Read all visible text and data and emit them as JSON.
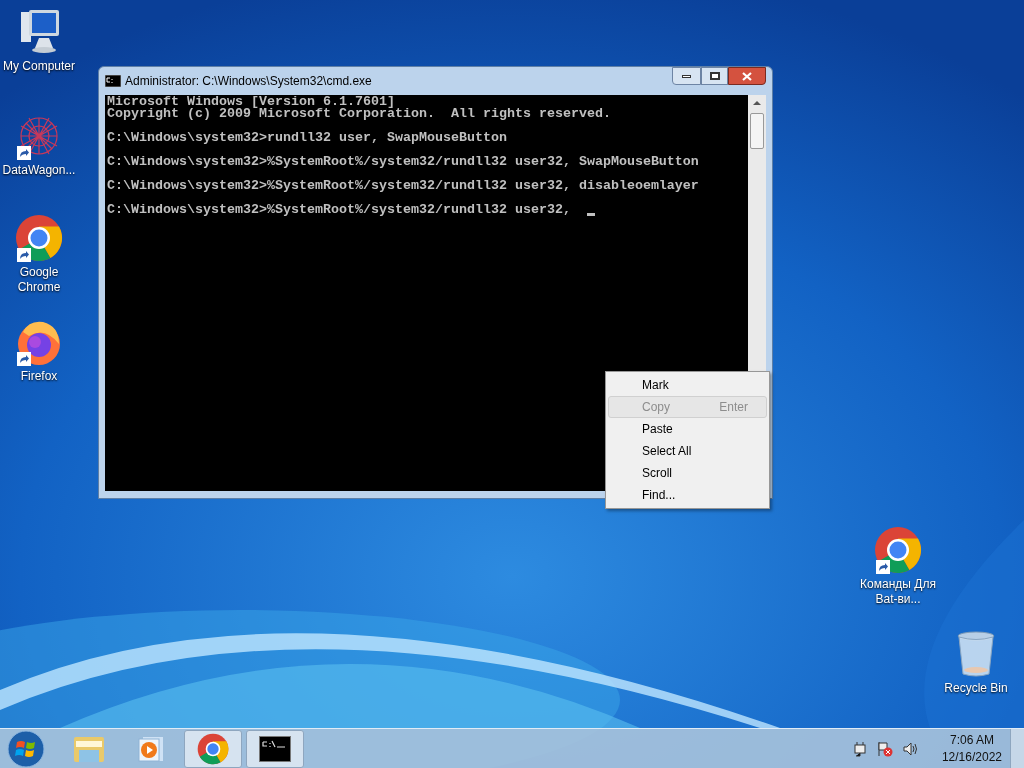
{
  "desktop_icons": [
    {
      "kind": "computer",
      "label": "My Computer",
      "shortcut": false
    },
    {
      "kind": "datawagon",
      "label": "DataWagon...",
      "shortcut": true
    },
    {
      "kind": "chrome",
      "label": "Google Chrome",
      "shortcut": true
    },
    {
      "kind": "firefox",
      "label": "Firefox",
      "shortcut": true
    },
    {
      "kind": "chrome",
      "label": "Команды Для Bat-ви...",
      "shortcut": true
    },
    {
      "kind": "recycle",
      "label": "Recycle Bin",
      "shortcut": false
    }
  ],
  "window": {
    "title": "Administrator: C:\\Windows\\System32\\cmd.exe",
    "console": {
      "blocks": [
        [
          "Microsoft Windows [Version 6.1.7601]",
          "Copyright (c) 2009 Microsoft Corporation.  All rights reserved."
        ],
        [
          "C:\\Windows\\system32>rundll32 user, SwapMouseButton"
        ],
        [
          "C:\\Windows\\system32>%SystemRoot%/system32/rundll32 user32, SwapMouseButton"
        ],
        [
          "C:\\Windows\\system32>%SystemRoot%/system32/rundll32 user32, disableoemlayer"
        ],
        [
          "C:\\Windows\\system32>%SystemRoot%/system32/rundll32 user32, "
        ]
      ],
      "cursor": true
    }
  },
  "context_menu": [
    {
      "label": "Mark",
      "disabled": false,
      "selected": false
    },
    {
      "label": "Copy",
      "shortcut": "Enter",
      "disabled": true,
      "selected": true
    },
    {
      "label": "Paste",
      "disabled": false,
      "selected": false
    },
    {
      "label": "Select All",
      "disabled": false,
      "selected": false
    },
    {
      "label": "Scroll",
      "disabled": false,
      "selected": false
    },
    {
      "label": "Find...",
      "disabled": false,
      "selected": false
    }
  ],
  "taskbar": {
    "items": [
      {
        "kind": "explorer",
        "running": false
      },
      {
        "kind": "media",
        "running": false
      },
      {
        "kind": "chrome",
        "running": true
      },
      {
        "kind": "cmd",
        "running": true
      }
    ],
    "clock": {
      "time": "7:06 AM",
      "date": "12/16/2022"
    }
  }
}
